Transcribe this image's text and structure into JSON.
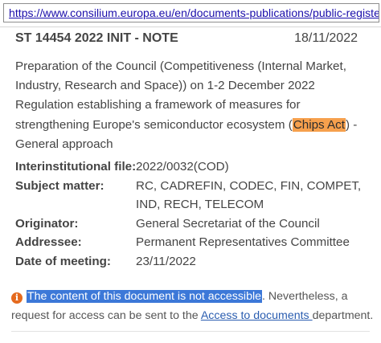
{
  "address_bar": {
    "url": "https://www.consilium.europa.eu/en/documents-publications/public-register/publ"
  },
  "document": {
    "id": "ST 14454 2022 INIT - NOTE",
    "date": "18/11/2022",
    "title_lines": [
      "Preparation of the Council (Competitiveness (Internal Market,",
      "Industry, Research and Space)) on 1-2 December 2022",
      "Regulation establishing a framework of measures for",
      "strengthening Europe's semiconductor ecosystem (",
      "Chips Act",
      ") -",
      "General approach"
    ]
  },
  "metadata": {
    "interinstitutional_file": {
      "label": "Interinstitutional file:",
      "value": "2022/0032(COD)"
    },
    "subject_matter": {
      "label": "Subject matter:",
      "value_line1": "RC, CADREFIN, CODEC, FIN, COMPET,",
      "value_line2": "IND, RECH, TELECOM"
    },
    "originator": {
      "label": "Originator:",
      "value": "General Secretariat of the Council"
    },
    "addressee": {
      "label": "Addressee:",
      "value": "Permanent Representatives Committee"
    },
    "date_of_meeting": {
      "label": "Date of meeting:",
      "value": "23/11/2022"
    }
  },
  "notice": {
    "icon": "info-icon",
    "highlighted_text": "The content of this document is not accessible",
    "text_after_highlight": ". Nevertheless, a",
    "line2_before_link": "request for access can be sent to the ",
    "link_text": "Access to documents ",
    "line2_after_link": "department."
  },
  "colors": {
    "chips_act_highlight": "#f6a04d",
    "selection_highlight": "#3c78d8",
    "link": "#2a5db0",
    "info_icon": "#e56a1e"
  }
}
